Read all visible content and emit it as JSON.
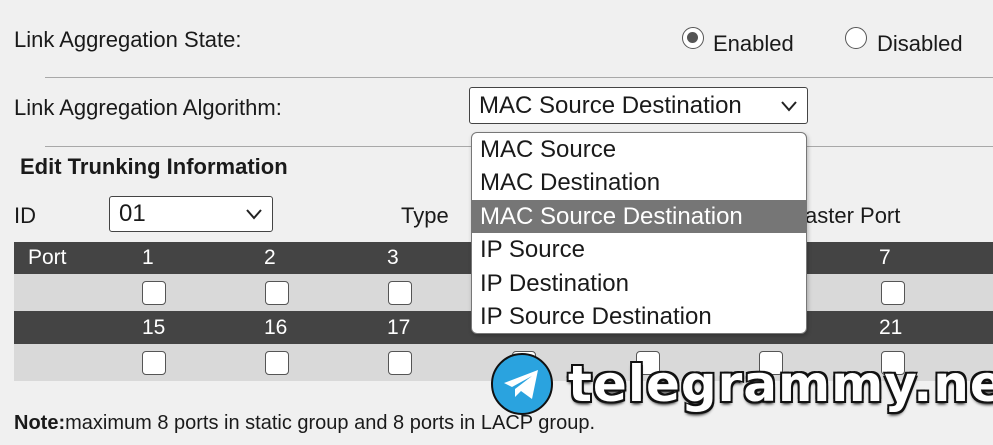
{
  "state": {
    "label": "Link Aggregation State:",
    "options": [
      {
        "label": "Enabled",
        "checked": true
      },
      {
        "label": "Disabled",
        "checked": false
      }
    ]
  },
  "algorithm": {
    "label": "Link Aggregation Algorithm:",
    "selected": "MAC Source Destination",
    "options": [
      "MAC Source",
      "MAC Destination",
      "MAC Source Destination",
      "IP Source",
      "IP Destination",
      "IP Source Destination"
    ],
    "highlighted_index": 2
  },
  "trunking": {
    "title": "Edit Trunking Information",
    "id_label": "ID",
    "id_value": "01",
    "type_label": "Type",
    "master_label_partial": "aster Port",
    "port_header": "Port",
    "row1_ports": [
      "1",
      "2",
      "3",
      "7"
    ],
    "row2_ports": [
      "15",
      "16",
      "17",
      "21"
    ]
  },
  "note": {
    "bold": "Note:",
    "text": "maximum 8 ports in static group and 8 ports in LACP group."
  },
  "watermark": "telegrammy.net",
  "colors": {
    "header_band": "#444444",
    "checkbox_band": "#d9d9d9",
    "highlight": "#767676",
    "telegram_blue": "#2aa3df"
  }
}
